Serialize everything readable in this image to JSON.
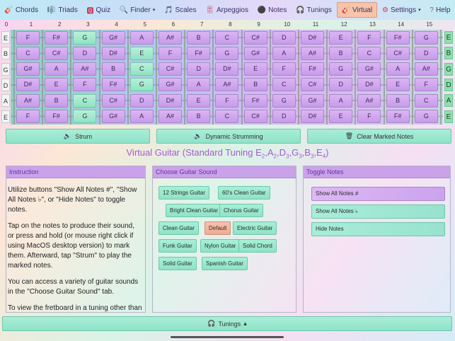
{
  "nav": [
    {
      "label": "Chords",
      "icon": "🎸"
    },
    {
      "label": "Triads",
      "icon": "🎼"
    },
    {
      "label": "Quiz",
      "icon": "🆀"
    },
    {
      "label": "Finder",
      "icon": "🔍",
      "caret": "▾"
    },
    {
      "label": "Scales",
      "icon": "🎵"
    },
    {
      "label": "Arpeggios",
      "icon": "🎚"
    },
    {
      "label": "Notes",
      "icon": "⚫"
    },
    {
      "label": "Tunings",
      "icon": "🎧"
    },
    {
      "label": "Virtual",
      "icon": "🎸",
      "active": true
    },
    {
      "label": "Settings",
      "icon": "⚙",
      "caret": "▾"
    },
    {
      "label": "Help",
      "icon": "?"
    }
  ],
  "fret_numbers": [
    "0",
    "1",
    "2",
    "3",
    "4",
    "5",
    "6",
    "7",
    "8",
    "9",
    "10",
    "11",
    "12",
    "13",
    "14",
    "15"
  ],
  "strings_left": [
    "E",
    "B",
    "G",
    "D",
    "A",
    "E"
  ],
  "strings_right": [
    "E",
    "B",
    "G",
    "D",
    "A",
    "E"
  ],
  "fretboard": [
    [
      "F",
      "F#",
      "G",
      "G#",
      "A",
      "A#",
      "B",
      "C",
      "C#",
      "D",
      "D#",
      "E",
      "F",
      "F#",
      "G"
    ],
    [
      "C",
      "C#",
      "D",
      "D#",
      "E",
      "F",
      "F#",
      "G",
      "G#",
      "A",
      "A#",
      "B",
      "C",
      "C#",
      "D"
    ],
    [
      "G#",
      "A",
      "A#",
      "B",
      "C",
      "C#",
      "D",
      "D#",
      "E",
      "F",
      "F#",
      "G",
      "G#",
      "A",
      "A#"
    ],
    [
      "D#",
      "E",
      "F",
      "F#",
      "G",
      "G#",
      "A",
      "A#",
      "B",
      "C",
      "C#",
      "D",
      "D#",
      "E",
      "F"
    ],
    [
      "A#",
      "B",
      "C",
      "C#",
      "D",
      "D#",
      "E",
      "F",
      "F#",
      "G",
      "G#",
      "A",
      "A#",
      "B",
      "C"
    ],
    [
      "F",
      "F#",
      "G",
      "G#",
      "A",
      "A#",
      "B",
      "C",
      "C#",
      "D",
      "D#",
      "E",
      "F",
      "F#",
      "G"
    ]
  ],
  "highlighted": [
    [
      0,
      2
    ],
    [
      1,
      4
    ],
    [
      2,
      4
    ],
    [
      3,
      4
    ],
    [
      4,
      2
    ],
    [
      5,
      2
    ]
  ],
  "actions": {
    "strum": "Strum",
    "strum_icon": "🔈",
    "dynamic": "Dynamic Strumming",
    "dynamic_icon": "🔈",
    "clear": "Clear Marked Notes",
    "clear_icon": "🗑"
  },
  "title": {
    "prefix": "Virtual Guitar (Standard Tuning ",
    "notes": [
      [
        "E",
        "2"
      ],
      [
        "A",
        "2"
      ],
      [
        "D",
        "3"
      ],
      [
        "G",
        "3"
      ],
      [
        "B",
        "3"
      ],
      [
        "E",
        "4"
      ]
    ],
    "sep": ",",
    "suffix": ")"
  },
  "instruction": {
    "header": "Instruction",
    "paragraphs": [
      "Utilize buttons \"Show All Notes #\", \"Show All Notes ♭\", or \"Hide Notes\" to toggle notes.",
      "Tap on the notes to produce their sound, or press and hold (or mouse right click if using MacOS desktop version) to mark them. Afterward, tap \"Strum\" to play the marked notes.",
      "You can access a variety of guitar sounds in the \"Choose Guitar Sound\" tab.",
      "To view the fretboard in a tuning other than Standard Tuning, you can do so by selecting one of"
    ]
  },
  "sound": {
    "header": "Choose Guitar Sound",
    "buttons": [
      "12 Strings Guitar",
      "60's Clean Guitar",
      "Bright Clean Guitar",
      "Chorus Guitar",
      "Clean Guitar",
      "Default",
      "Electric Guitar",
      "Funk Guitar",
      "Nylon Guitar",
      "Solid Chord",
      "Solid Guitar",
      "Spanish Guitar"
    ],
    "selected": "Default"
  },
  "toggle": {
    "header": "Toggle Notes",
    "buttons": [
      "Show All Notes #",
      "Show All Notes ♭",
      "Hide Notes"
    ],
    "selected": "Show All Notes #"
  },
  "bottom": {
    "label": "Tunings",
    "icon": "🎧",
    "caret": "▴"
  }
}
